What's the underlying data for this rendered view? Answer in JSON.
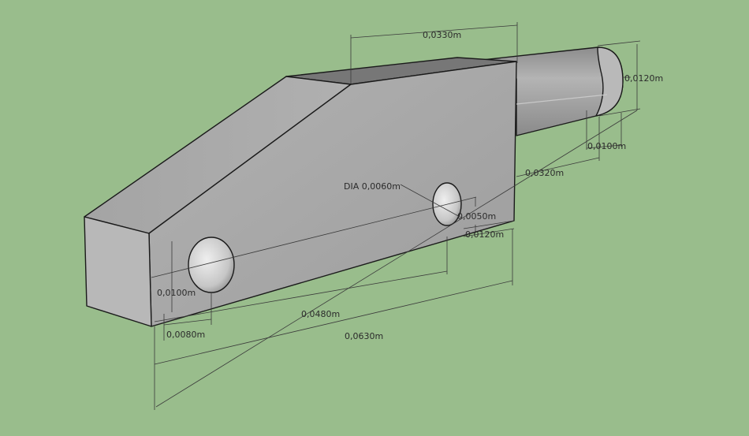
{
  "model_view": {
    "background_color": "#99bd8c",
    "part_colors": {
      "top_face": "#7b7b7b",
      "front_face": "#a9a9a9",
      "side_face": "#b8b8b8",
      "shaft": "#9e9e9e",
      "hole": "#d7d7d7"
    }
  },
  "dimensions": {
    "top_width": "0,0330m",
    "shaft_dia": "0,0120m",
    "shaft_end": "0,0100m",
    "shaft_length": "0,0320m",
    "hole_dia": "DIA 0,0060m",
    "hole_offset": "0,0050m",
    "bottom_offset": "0,0120m",
    "hole_height": "0,0100m",
    "hole_spacing": "0,0480m",
    "edge_to_hole": "0,0080m",
    "total_length": "0,0630m"
  }
}
